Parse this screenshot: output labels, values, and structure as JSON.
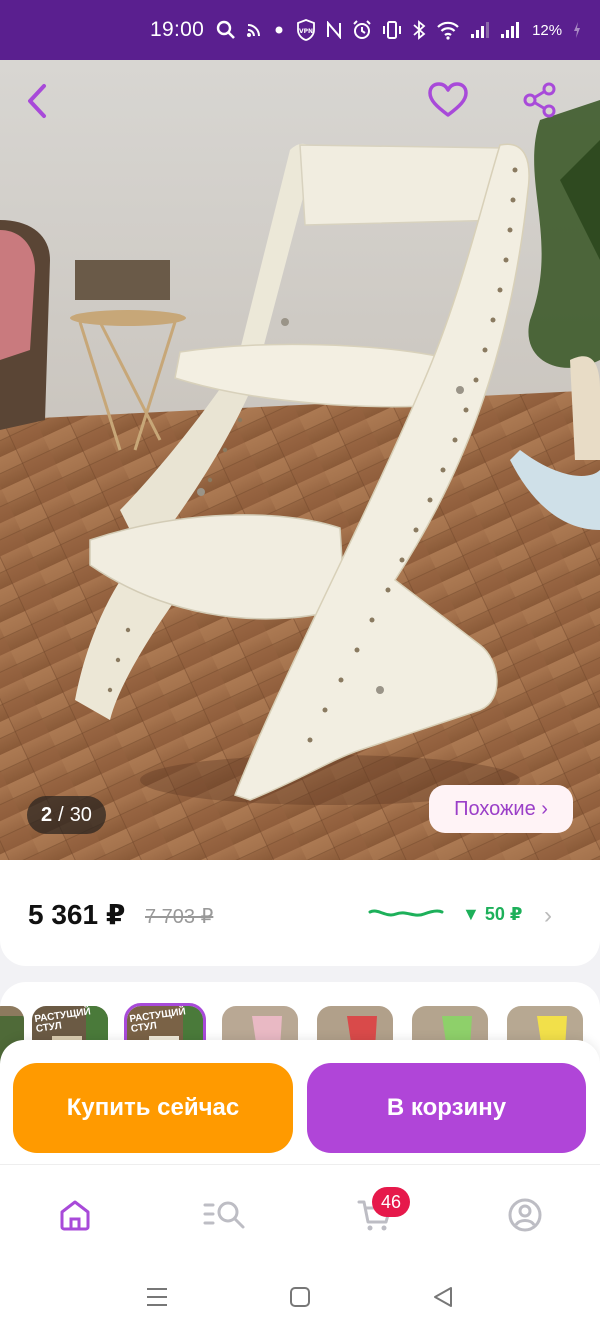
{
  "status_bar": {
    "time": "19:00",
    "battery": "12%",
    "icons": [
      "search-icon",
      "cast-icon",
      "dot-icon",
      "vpn-icon",
      "nfc-icon",
      "alarm-icon",
      "vibrate-icon",
      "bluetooth-icon",
      "wifi-icon",
      "signal-icon",
      "signal-icon",
      "battery-icon"
    ]
  },
  "gallery": {
    "current": "2",
    "separator": "/",
    "total": "30",
    "similar_label": "Похожие ›"
  },
  "price": {
    "current": "5 361 ₽",
    "old": "7 703 ₽",
    "drop": "▼ 50 ₽"
  },
  "variants": {
    "thumb_label": "РАСТУЩИЙ СТУЛ",
    "selected_index": 1
  },
  "actions": {
    "buy_now": "Купить сейчас",
    "add_to_cart": "В корзину"
  },
  "bottom_nav": {
    "cart_count": "46",
    "items": [
      "home-icon",
      "catalog-search-icon",
      "cart-icon",
      "profile-icon"
    ],
    "active": "home-icon"
  },
  "colors": {
    "accent": "#a84ad9",
    "buy": "#ff9a00",
    "cart": "#b045d8",
    "status_bar": "#5a1f8f",
    "price_drop": "#1db05a",
    "badge": "#e6194b"
  }
}
